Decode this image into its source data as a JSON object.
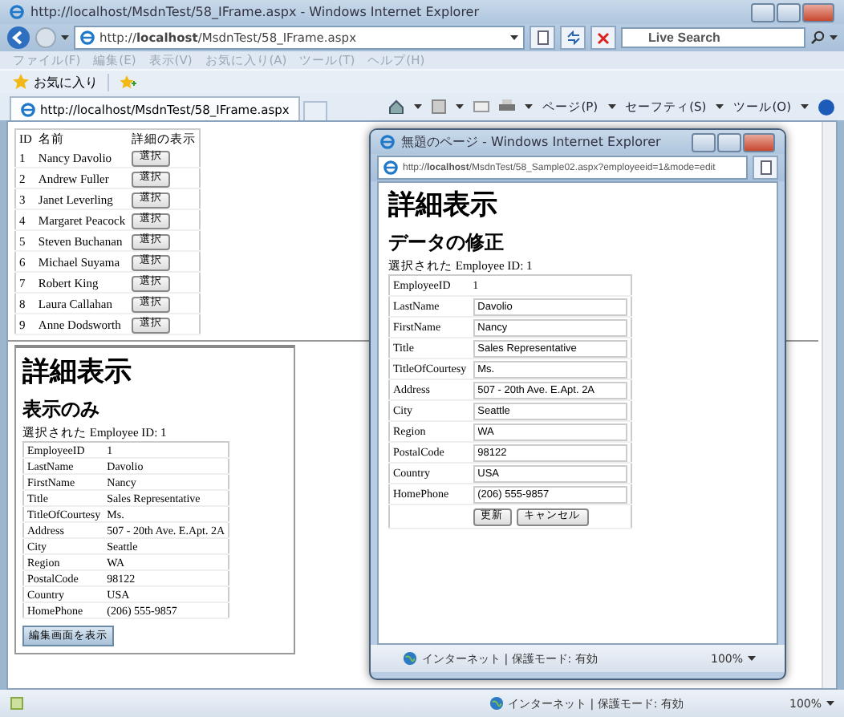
{
  "window": {
    "title": "http://localhost/MsdnTest/58_IFrame.aspx - Windows Internet Explorer"
  },
  "address_bar": {
    "value": "http://**localhost**/MsdnTest/58_IFrame.aspx"
  },
  "search": {
    "placeholder": "Live Search"
  },
  "menu": [
    "ファイル(F)",
    "編集(E)",
    "表示(V)",
    "お気に入り(A)",
    "ツール(T)",
    "ヘルプ(H)"
  ],
  "favorites": {
    "label": "お気に入り"
  },
  "tabs": [
    {
      "label": "http://localhost/MsdnTest/58_IFrame.aspx",
      "selected": true
    }
  ],
  "command_bar": [
    "ページ(P)",
    "セーフティ(S)",
    "ツール(O)"
  ],
  "employee_list": {
    "columns": [
      "ID",
      "名前",
      "詳細の表示"
    ],
    "rows": [
      {
        "id": "1",
        "name": "Nancy Davolio",
        "button": "選択"
      },
      {
        "id": "2",
        "name": "Andrew Fuller",
        "button": "選択"
      },
      {
        "id": "3",
        "name": "Janet Leverling",
        "button": "選択"
      },
      {
        "id": "4",
        "name": "Margaret Peacock",
        "button": "選択"
      },
      {
        "id": "5",
        "name": "Steven Buchanan",
        "button": "選択"
      },
      {
        "id": "6",
        "name": "Michael Suyama",
        "button": "選択"
      },
      {
        "id": "7",
        "name": "Robert King",
        "button": "選択"
      },
      {
        "id": "8",
        "name": "Laura Callahan",
        "button": "選択"
      },
      {
        "id": "9",
        "name": "Anne Dodsworth",
        "button": "選択"
      }
    ]
  },
  "detail_frame": {
    "heading": "詳細表示",
    "subheading": "表示のみ",
    "caption": "選択された Employee ID: 1",
    "fields": [
      {
        "label": "EmployeeID",
        "value": "1"
      },
      {
        "label": "LastName",
        "value": "Davolio"
      },
      {
        "label": "FirstName",
        "value": "Nancy"
      },
      {
        "label": "Title",
        "value": "Sales Representative"
      },
      {
        "label": "TitleOfCourtesy",
        "value": "Ms."
      },
      {
        "label": "Address",
        "value": "507 - 20th Ave. E.Apt. 2A"
      },
      {
        "label": "City",
        "value": "Seattle"
      },
      {
        "label": "Region",
        "value": "WA"
      },
      {
        "label": "PostalCode",
        "value": "98122"
      },
      {
        "label": "Country",
        "value": "USA"
      },
      {
        "label": "HomePhone",
        "value": "(206) 555-9857"
      }
    ],
    "button": "編集画面を表示"
  },
  "popup": {
    "title": "無題のページ - Windows Internet Explorer",
    "address": "http://**localhost**/MsdnTest/58_Sample02.aspx?employeeid=1&mode=edit",
    "heading": "詳細表示",
    "subheading": "データの修正",
    "caption": "選択された Employee ID: 1",
    "fields": [
      {
        "label": "EmployeeID",
        "value": "1",
        "kind": "text"
      },
      {
        "label": "LastName",
        "value": "Davolio",
        "kind": "input"
      },
      {
        "label": "FirstName",
        "value": "Nancy",
        "kind": "input"
      },
      {
        "label": "Title",
        "value": "Sales Representative",
        "kind": "input"
      },
      {
        "label": "TitleOfCourtesy",
        "value": "Ms.",
        "kind": "input"
      },
      {
        "label": "Address",
        "value": "507 - 20th Ave. E.Apt. 2A",
        "kind": "input"
      },
      {
        "label": "City",
        "value": "Seattle",
        "kind": "input"
      },
      {
        "label": "Region",
        "value": "WA",
        "kind": "input"
      },
      {
        "label": "PostalCode",
        "value": "98122",
        "kind": "input"
      },
      {
        "label": "Country",
        "value": "USA",
        "kind": "input"
      },
      {
        "label": "HomePhone",
        "value": "(206) 555-9857",
        "kind": "input"
      }
    ],
    "buttons": [
      "更新",
      "キャンセル"
    ],
    "status": {
      "zone": "インターネット | 保護モード: 有効",
      "zoom": "100%"
    }
  },
  "status_bar": {
    "zone": "インターネット | 保護モード: 有効",
    "zoom": "100%"
  }
}
